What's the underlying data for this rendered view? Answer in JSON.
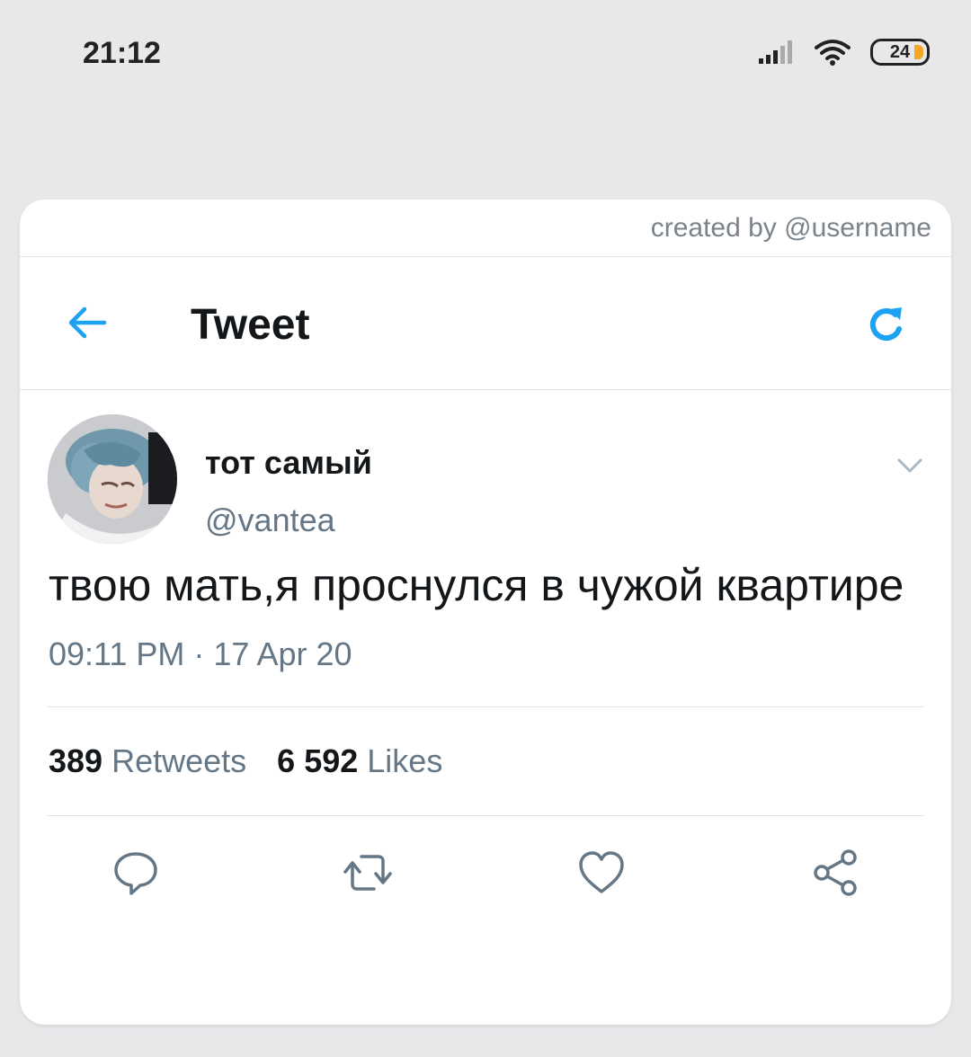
{
  "status_bar": {
    "time": "21:12",
    "battery": "24",
    "icons": [
      "signal-icon",
      "wifi-icon",
      "battery-icon"
    ]
  },
  "credit": "created by @username",
  "header": {
    "title": "Tweet",
    "back_icon": "back-arrow-icon",
    "refresh_icon": "refresh-icon"
  },
  "tweet": {
    "display_name": "тот самый",
    "handle": "@vantea",
    "text": "твою мать,я проснулся в чужой квартире",
    "timestamp": "09:11 PM · 17 Apr 20",
    "retweets_count": "389",
    "retweets_label": "Retweets",
    "likes_count": "6 592",
    "likes_label": "Likes"
  },
  "actions": [
    "reply-icon",
    "retweet-icon",
    "like-icon",
    "share-icon"
  ],
  "colors": {
    "accent": "#1da1f2",
    "muted": "#657786",
    "text": "#14171a",
    "background": "#e8e7ea",
    "battery_fill": "#f5a623"
  }
}
